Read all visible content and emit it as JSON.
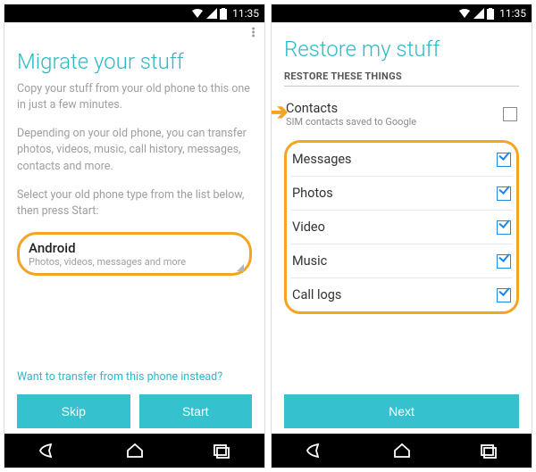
{
  "statusbar": {
    "time": "11:35"
  },
  "left": {
    "title": "Migrate your stuff",
    "p1": "Copy your stuff from your old phone to this one in just a few minutes.",
    "p2": "Depending on your old phone, you can transfer photos, videos, music, call history, messages, contacts and more.",
    "p3": "Select your old phone type from the list below, then press Start:",
    "selector": {
      "title": "Android",
      "sub": "Photos, videos, messages and more"
    },
    "link": "Want to transfer from this phone instead?",
    "skip": "Skip",
    "start": "Start"
  },
  "right": {
    "title": "Restore my stuff",
    "section": "RESTORE THESE THINGS",
    "contacts": {
      "label": "Contacts",
      "sub": "SIM contacts saved to Google"
    },
    "items": {
      "messages": "Messages",
      "photos": "Photos",
      "video": "Video",
      "music": "Music",
      "calllogs": "Call logs"
    },
    "next": "Next"
  }
}
